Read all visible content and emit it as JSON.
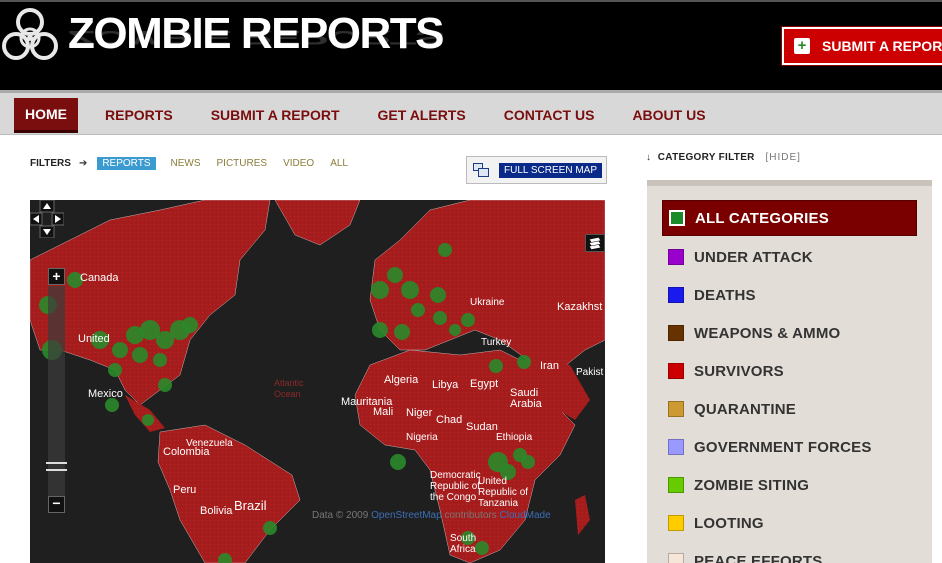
{
  "site": {
    "title": "ZOMBIE REPORTS",
    "submit_button": "SUBMIT A REPORT",
    "colors": {
      "header_bg": "#000000",
      "brand_red": "#7a0d0d",
      "accent_red": "#cc0000",
      "map_marker": "#2a8a2a"
    }
  },
  "nav": {
    "items": [
      {
        "label": "HOME",
        "active": true
      },
      {
        "label": "REPORTS"
      },
      {
        "label": "SUBMIT A REPORT"
      },
      {
        "label": "GET ALERTS"
      },
      {
        "label": "CONTACT US"
      },
      {
        "label": "ABOUT US"
      }
    ]
  },
  "filters": {
    "label": "FILTERS",
    "arrow_icon": "arrow-right-icon",
    "items": [
      {
        "label": "REPORTS",
        "active": true
      },
      {
        "label": "NEWS"
      },
      {
        "label": "PICTURES"
      },
      {
        "label": "VIDEO"
      },
      {
        "label": "ALL"
      }
    ]
  },
  "map": {
    "fullscreen_label": "FULL SCREEN MAP",
    "labels": [
      "Canada",
      "United",
      "Mexico",
      "Venezuela",
      "Colombia",
      "Peru",
      "Brazil",
      "Bolivia",
      "Ukraine",
      "Kazakhst",
      "Turkey",
      "Iran",
      "Pakist",
      "Algeria",
      "Libya",
      "Egypt",
      "Saudi Arabia",
      "Mauritania",
      "Mali",
      "Niger",
      "Chad",
      "Sudan",
      "Nigeria",
      "Ethiopia",
      "Democratic Republic of the Congo",
      "United Republic of Tanzania",
      "South Africa",
      "Atlantic Ocean"
    ],
    "copyright": {
      "prefix": "Data © 2009",
      "link1": "OpenStreetMap",
      "middle": "contributors",
      "link2": "CloudMade"
    }
  },
  "category_filter": {
    "title": "CATEGORY FILTER",
    "hide_label": "[HIDE]",
    "categories": [
      {
        "label": "ALL CATEGORIES",
        "color": "#1a8a2a",
        "active": true
      },
      {
        "label": "UNDER ATTACK",
        "color": "#9900cc"
      },
      {
        "label": "DEATHS",
        "color": "#1a1aee"
      },
      {
        "label": "WEAPONS & AMMO",
        "color": "#663300"
      },
      {
        "label": "SURVIVORS",
        "color": "#cc0000"
      },
      {
        "label": "QUARANTINE",
        "color": "#cc9933"
      },
      {
        "label": "GOVERNMENT FORCES",
        "color": "#9999ff"
      },
      {
        "label": "ZOMBIE SITING",
        "color": "#66cc00"
      },
      {
        "label": "LOOTING",
        "color": "#ffcc00"
      },
      {
        "label": "PEACE EFFORTS",
        "color": "#f5e6d8"
      }
    ]
  }
}
